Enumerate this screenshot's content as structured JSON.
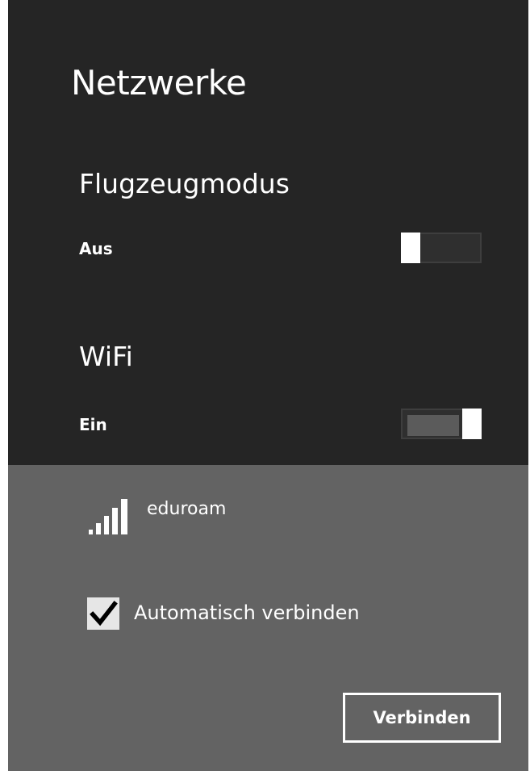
{
  "page": {
    "title": "Netzwerke"
  },
  "airplane_mode": {
    "title": "Flugzeugmodus",
    "state_label": "Aus",
    "on": false
  },
  "wifi": {
    "title": "WiFi",
    "state_label": "Ein",
    "on": true
  },
  "network": {
    "name": "eduroam",
    "signal_icon": "wifi-signal-bars-icon",
    "signal_bars": 5,
    "auto_connect_label": "Automatisch verbinden",
    "auto_connect_checked": true,
    "connect_label": "Verbinden"
  },
  "colors": {
    "panel_background": "#252525",
    "network_background": "#636363",
    "text": "#ffffff"
  }
}
